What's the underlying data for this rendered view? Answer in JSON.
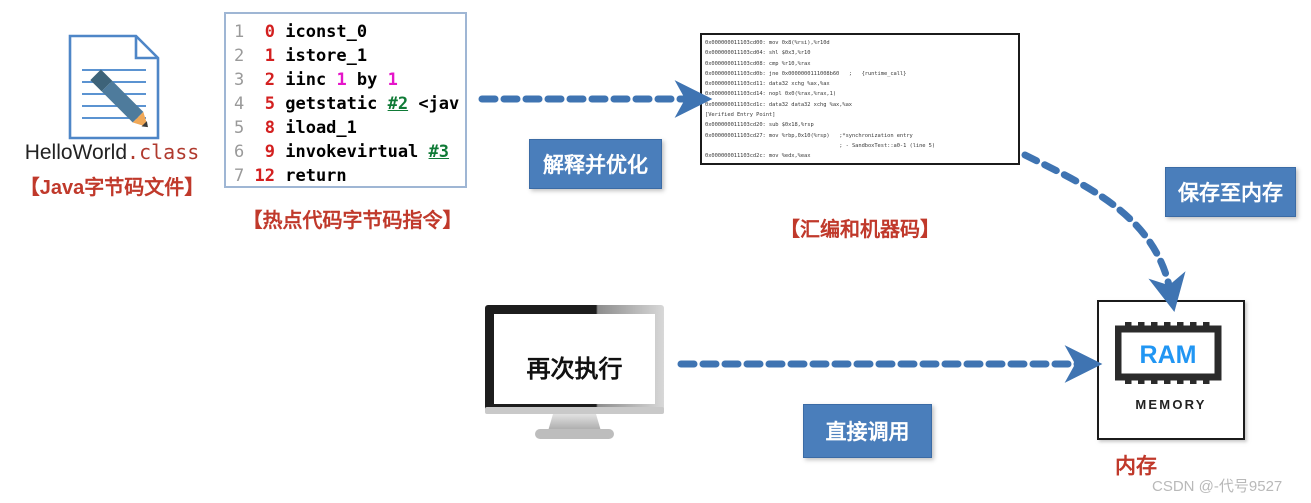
{
  "diagram": {
    "title": "JIT compilation flow"
  },
  "class_file": {
    "icon": "document-with-pencil-icon",
    "name_base": "HelloWorld",
    "name_ext": ".class",
    "caption": "【Java字节码文件】"
  },
  "bytecode_panel": {
    "caption": "【热点代码字节码指令】",
    "lines": [
      {
        "line_no": "1",
        "offset": "0",
        "mnemonic": "iconst_0",
        "operand": "",
        "operand_type": "none",
        "tail": ""
      },
      {
        "line_no": "2",
        "offset": "1",
        "mnemonic": "istore_1",
        "operand": "",
        "operand_type": "none",
        "tail": ""
      },
      {
        "line_no": "3",
        "offset": "2",
        "mnemonic": "iinc",
        "operand": "1",
        "operand_type": "num",
        "tail": " by ",
        "operand2": "1"
      },
      {
        "line_no": "4",
        "offset": "5",
        "mnemonic": "getstatic",
        "operand": "#2",
        "operand_type": "ref",
        "tail": " <jav"
      },
      {
        "line_no": "5",
        "offset": "8",
        "mnemonic": "iload_1",
        "operand": "",
        "operand_type": "none",
        "tail": ""
      },
      {
        "line_no": "6",
        "offset": "9",
        "mnemonic": "invokevirtual",
        "operand": "#3",
        "operand_type": "ref",
        "tail": ""
      },
      {
        "line_no": "7",
        "offset": "12",
        "mnemonic": "return",
        "operand": "",
        "operand_type": "none",
        "tail": ""
      }
    ]
  },
  "assembly_panel": {
    "caption": "【汇编和机器码】",
    "lines": [
      "0x000000011103cd00: mov 0x8(%rsi),%r10d",
      "0x000000011103cd04: shl $0x3,%r10",
      "0x000000011103cd08: cmp %r10,%rax",
      "0x000000011103cd0b: jne 0x0000000111008b60   ;   {runtime_call}",
      "0x000000011103cd11: data32 xchg %ax,%ax",
      "0x000000011103cd14: nopl 0x0(%rax,%rax,1)",
      "0x000000011103cd1c: data32 data32 xchg %ax,%ax",
      "[Verified Entry Point]",
      "0x000000011103cd20: sub $0x18,%rsp",
      "0x000000011103cd27: mov %rbp,0x10(%rsp)   ;*synchronization entry",
      "                                          ; - SandboxTest::a0-1 (line 5)",
      "0x000000011103cd2c: mov %edx,%eax"
    ]
  },
  "labels": {
    "interpret_optimize": "解释并优化",
    "save_to_memory": "保存至内存",
    "direct_call": "直接调用"
  },
  "monitor": {
    "icon": "desktop-monitor-icon",
    "screen_text": "再次执行"
  },
  "memory": {
    "chip_text": "RAM",
    "chip_text_color": "#2196f3",
    "sub_label": "MEMORY",
    "caption": "内存"
  },
  "watermark": {
    "text": "CSDN @-代号9527"
  },
  "arrows": [
    {
      "name": "bytecode-to-assembly-arrow",
      "style": "dashed-straight",
      "color": "#4a7ebb"
    },
    {
      "name": "assembly-to-memory-arrow",
      "style": "dashed-curved",
      "color": "#4a7ebb"
    },
    {
      "name": "monitor-to-memory-arrow",
      "style": "dashed-straight",
      "color": "#4a7ebb"
    }
  ],
  "colors": {
    "accent_blue": "#4a7ebb",
    "caption_red": "#c0392b",
    "code_border": "#9fb6d4",
    "assembly_border": "#1b1b1b"
  }
}
